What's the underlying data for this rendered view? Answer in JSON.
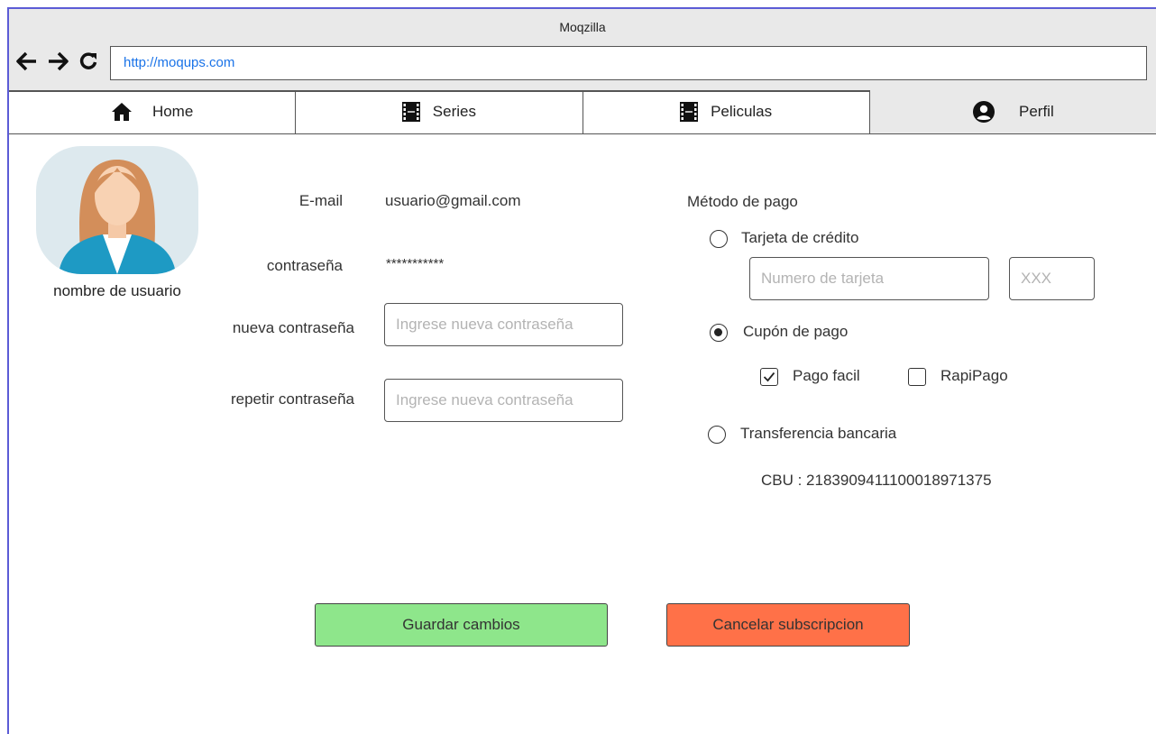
{
  "window": {
    "title": "Moqzilla"
  },
  "browser": {
    "url": "http://moqups.com"
  },
  "tabs": [
    {
      "label": "Home",
      "icon": "home-icon"
    },
    {
      "label": "Series",
      "icon": "film-icon"
    },
    {
      "label": "Peliculas",
      "icon": "film-icon"
    },
    {
      "label": "Perfil",
      "icon": "user-circle-icon"
    }
  ],
  "profile": {
    "username": "nombre de usuario",
    "email_label": "E-mail",
    "email_value": "usuario@gmail.com",
    "password_label": "contraseña",
    "password_value": "***********",
    "new_password_label": "nueva contraseña",
    "new_password_placeholder": "Ingrese nueva contraseña",
    "repeat_password_label": "repetir contraseña",
    "repeat_password_placeholder": "Ingrese nueva contraseña"
  },
  "payment": {
    "heading": "Método de pago",
    "credit_card_label": "Tarjeta de crédito",
    "card_number_placeholder": "Numero de tarjeta",
    "cvv_placeholder": "XXX",
    "coupon_label": "Cupón de pago",
    "pago_facil_label": "Pago facil",
    "rapipago_label": "RapiPago",
    "transfer_label": "Transferencia bancaria",
    "cbu_text": "CBU : 2183909411100018971375"
  },
  "actions": {
    "save_label": "Guardar cambios",
    "cancel_label": "Cancelar subscripcion"
  },
  "colors": {
    "save_button": "#8ee68b",
    "cancel_button": "#ff7148",
    "url_text": "#1a73e8",
    "active_tab": "#e9e9e9"
  }
}
